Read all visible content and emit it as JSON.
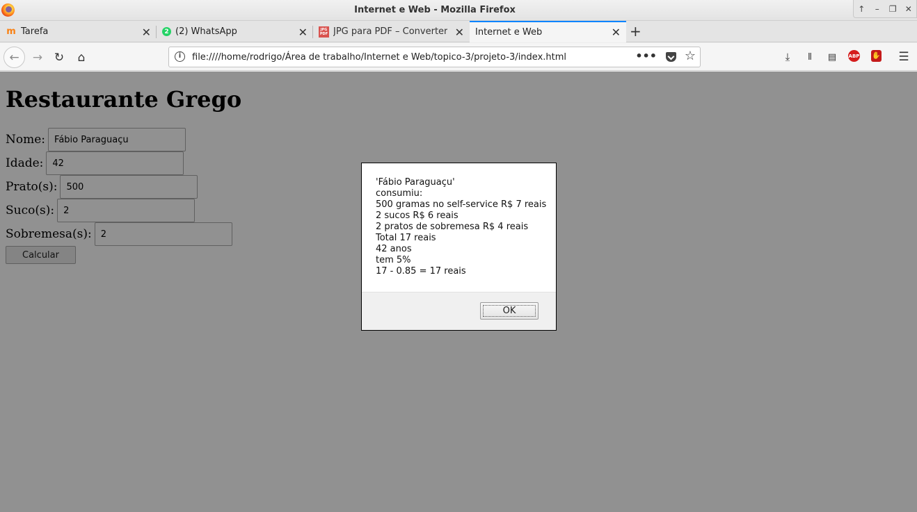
{
  "window": {
    "title": "Internet e Web - Mozilla Firefox",
    "controls": [
      "↑",
      "–",
      "❐",
      "✕"
    ]
  },
  "tabs": [
    {
      "label": "Tarefa",
      "icon": "moodle-icon",
      "icon_color": "#f98012"
    },
    {
      "label": "(2) WhatsApp",
      "icon": "whatsapp-icon",
      "icon_color": "#25d366",
      "badge": "2"
    },
    {
      "label": "JPG para PDF – Converter",
      "icon": "jpg-pdf-icon",
      "icon_color": "#d9534f",
      "icon_text": "JPG PDF"
    },
    {
      "label": "Internet e Web",
      "active": true
    }
  ],
  "navbar": {
    "url": "file:////home/rodrigo/Área de trabalho/Internet e Web/topico-3/projeto-3/index.html",
    "info_glyph": "i",
    "dots": "•••"
  },
  "page": {
    "heading": "Restaurante Grego",
    "fields": [
      {
        "label": "Nome:",
        "value": "Fábio Paraguaçu"
      },
      {
        "label": "Idade:",
        "value": "42"
      },
      {
        "label": "Prato(s):",
        "value": "500"
      },
      {
        "label": "Suco(s):",
        "value": "2"
      },
      {
        "label": "Sobremesa(s):",
        "value": "2"
      }
    ],
    "calculate_label": "Calcular"
  },
  "dialog": {
    "lines": [
      "'Fábio Paraguaçu'",
      "consumiu:",
      "500 gramas no self-service R$ 7 reais",
      "2 sucos R$ 6 reais",
      "2 pratos de sobremesa R$ 4 reais",
      "Total 17 reais",
      "42 anos",
      "tem 5%",
      "17 - 0.85 = 17 reais"
    ],
    "ok_label": "OK"
  },
  "colors": {
    "active_tab_accent": "#0a84ff",
    "overlay": "rgba(0,0,0,0.43)",
    "abp_red": "#d51d1d"
  }
}
